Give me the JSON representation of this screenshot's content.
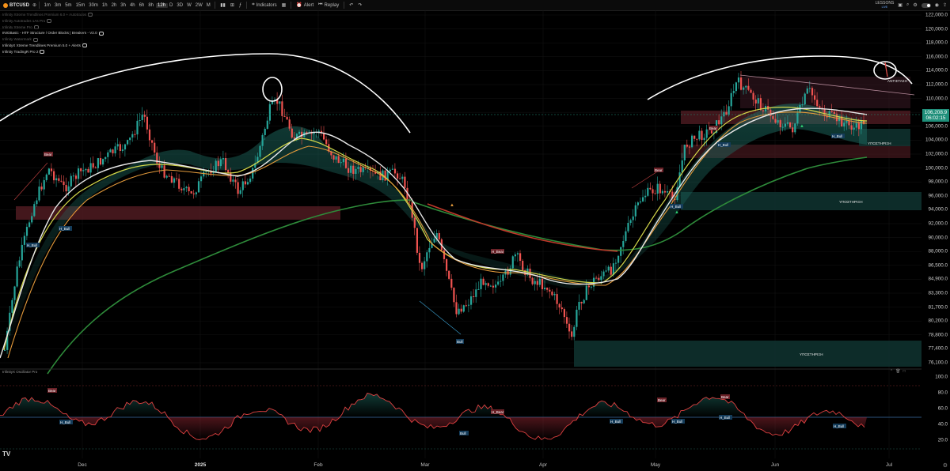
{
  "toolbar": {
    "symbol": "BTCUSD",
    "timeframes": [
      "1m",
      "3m",
      "5m",
      "15m",
      "30m",
      "1h",
      "2h",
      "3h",
      "4h",
      "6h",
      "8h",
      "12h",
      "D",
      "3D",
      "W",
      "2W",
      "M"
    ],
    "active_timeframe": "12h",
    "indicators_label": "Indicators",
    "alert_label": "Alert",
    "replay_label": "Replay",
    "lessons_label": "LESSONS",
    "lessons_sub": "LIVE"
  },
  "indicators": [
    {
      "label": "Infinity Xtreme Trendlines Premium 6.0 + Autotrades",
      "dim": true
    },
    {
      "label": "Infinity Autotrades 1As Pro",
      "dim": true
    },
    {
      "label": "Infinity Xtreme Pro",
      "dim": true
    },
    {
      "label": "INIGBasic - HTF Structure / Order Blocks | Breakers - V2.0",
      "dim": false
    },
    {
      "label": "Infinity Watermark",
      "dim": true
    },
    {
      "label": "InfinityX Xtreme Trendlines Premium 5.0 + Alerts",
      "dim": false
    },
    {
      "label": "Infinity TradingR Pro 2",
      "dim": false
    }
  ],
  "price_axis": [
    "122,000.0",
    "120,000.0",
    "118,000.0",
    "116,000.0",
    "114,000.0",
    "112,000.0",
    "110,000.0",
    "108,000.0",
    "106,000.0",
    "104,000.0",
    "102,000.0",
    "100,000.0",
    "98,000.0",
    "96,000.0",
    "94,000.0",
    "92,000.0",
    "90,000.0",
    "88,000.0",
    "86,500.0",
    "84,900.0",
    "83,300.0",
    "81,700.0",
    "80,200.0",
    "78,800.0",
    "77,400.0",
    "76,100.0"
  ],
  "last_price": {
    "price": "106,208.9",
    "countdown": "06:02:15",
    "color": "#1f8f7a"
  },
  "oscillator": {
    "title": "InfinityX Oscillator Pro",
    "axis": [
      "100.0",
      "80.0",
      "60.0",
      "40.0",
      "20.0"
    ]
  },
  "time_axis": [
    {
      "label": "Dec",
      "bold": false
    },
    {
      "label": "2025",
      "bold": true
    },
    {
      "label": "Feb",
      "bold": false
    },
    {
      "label": "Mar",
      "bold": false
    },
    {
      "label": "Apr",
      "bold": false
    },
    {
      "label": "May",
      "bold": false
    },
    {
      "label": "Jun",
      "bold": false
    },
    {
      "label": "Jul",
      "bold": false
    }
  ],
  "annotations": {
    "resistance": "ΑΝΤΙΣΤΑΣΗ",
    "support1": "ΥΠΟΣΤΗΡΙΞΗ",
    "support2": "ΥΠΟΣΤΗΡΙΞΗ",
    "support3": "ΥΠΟΣΤΗΡΙΞΗ"
  },
  "signals": {
    "bear": "Bear",
    "bull": "Bull",
    "h_bull": "H_Bull",
    "h_bear": "H_Bear"
  },
  "colors": {
    "bull": "#26a69a",
    "bear": "#ef5350",
    "ema_green": "#2e8b3a",
    "ema_red": "#c0392b",
    "ema_yellow": "#d4d84a",
    "ema_orange": "#e39a3b",
    "ribbon": "#e8e8e8",
    "zone_red": "#5a1f26",
    "zone_teal": "#0f3430"
  },
  "tv_logo": "TV"
}
